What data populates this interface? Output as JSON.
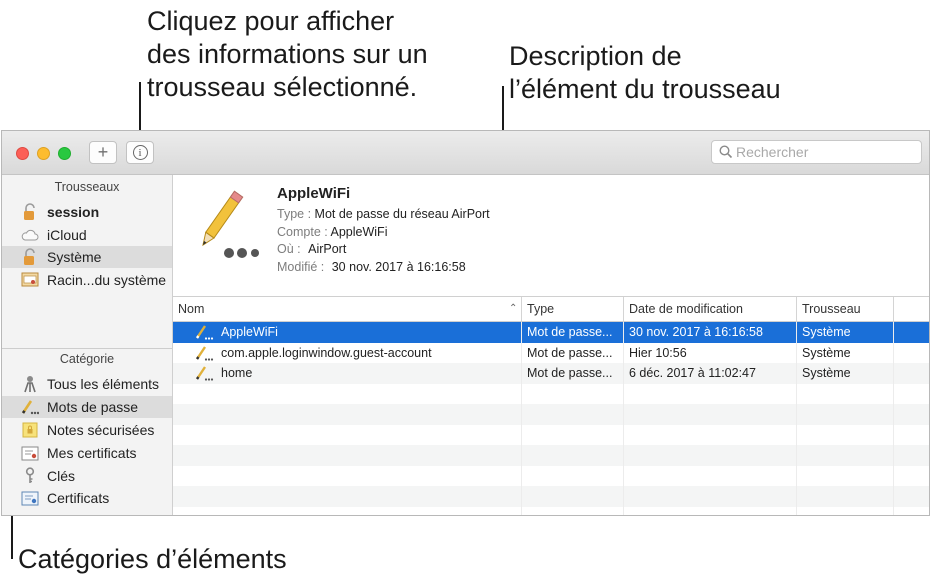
{
  "callouts": {
    "info": "Cliquez pour afficher\ndes informations sur un\ntrousseau sélectionné.",
    "description": "Description de\nl’élément du trousseau",
    "categories": "Catégories d’éléments"
  },
  "toolbar": {
    "add_label": "+",
    "info_label": "i",
    "search_placeholder": "Rechercher"
  },
  "sidebar": {
    "keychains_header": "Trousseaux",
    "keychains": [
      {
        "label": "session",
        "icon": "lock-open-icon",
        "bold": true
      },
      {
        "label": "iCloud",
        "icon": "cloud-icon"
      },
      {
        "label": "Système",
        "icon": "lock-icon",
        "selected": true
      },
      {
        "label": "Racin...du système",
        "icon": "certificate-folder-icon"
      }
    ],
    "category_header": "Catégorie",
    "categories": [
      {
        "label": "Tous les éléments",
        "icon": "people-icon"
      },
      {
        "label": "Mots de passe",
        "icon": "password-pencil-icon",
        "selected": true
      },
      {
        "label": "Notes sécurisées",
        "icon": "secure-note-icon"
      },
      {
        "label": "Mes certificats",
        "icon": "my-certificate-icon"
      },
      {
        "label": "Clés",
        "icon": "key-icon"
      },
      {
        "label": "Certificats",
        "icon": "certificate-icon"
      }
    ]
  },
  "detail": {
    "title": "AppleWiFi",
    "type_key": "Type :",
    "type_val": "Mot de passe du réseau AirPort",
    "account_key": "Compte :",
    "account_val": "AppleWiFi",
    "where_key": "Où :",
    "where_val": "AirPort",
    "modified_key": "Modifié :",
    "modified_val": "30 nov. 2017 à 16:16:58"
  },
  "table": {
    "columns": [
      "Nom",
      "Type",
      "Date de modification",
      "Trousseau"
    ],
    "rows": [
      {
        "name": "AppleWiFi",
        "type": "Mot de passe...",
        "date": "30 nov. 2017 à 16:16:58",
        "keychain": "Système",
        "selected": true
      },
      {
        "name": "com.apple.loginwindow.guest-account",
        "type": "Mot de passe...",
        "date": "Hier 10:56",
        "keychain": "Système"
      },
      {
        "name": "home",
        "type": "Mot de passe...",
        "date": "6 déc. 2017 à 11:02:47",
        "keychain": "Système"
      }
    ]
  },
  "colors": {
    "selection": "#1a6fd8",
    "close": "#fc5f57",
    "minimize": "#fdbc2e",
    "maximize": "#29c840"
  }
}
